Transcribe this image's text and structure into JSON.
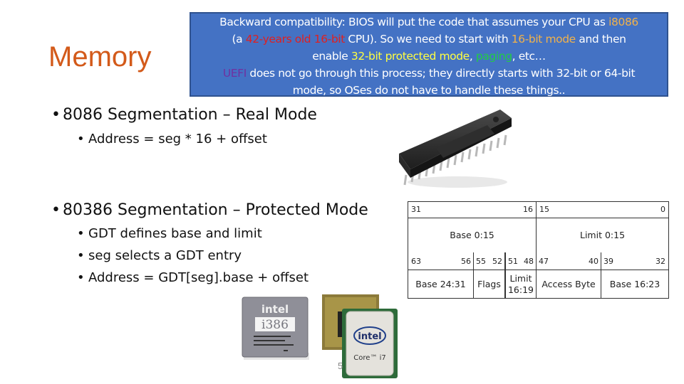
{
  "slide": {
    "title": "Memory",
    "page_number": "5"
  },
  "callout": {
    "lines": [
      [
        {
          "t": "Backward compatibility: BIOS will put the code that assumes your CPU as ",
          "c": "white"
        },
        {
          "t": "i8086",
          "c": "orange"
        }
      ],
      [
        {
          "t": "(a ",
          "c": "white"
        },
        {
          "t": "42-years old 16-bit",
          "c": "red"
        },
        {
          "t": " CPU). So we need to start with ",
          "c": "white"
        },
        {
          "t": "16-bit mode",
          "c": "orange"
        },
        {
          "t": " and then",
          "c": "white"
        }
      ],
      [
        {
          "t": "enable ",
          "c": "white"
        },
        {
          "t": "32-bit protected mode",
          "c": "yellow"
        },
        {
          "t": ", ",
          "c": "white"
        },
        {
          "t": "paging",
          "c": "green"
        },
        {
          "t": ", etc…",
          "c": "white"
        }
      ],
      [
        {
          "t": "UEFI",
          "c": "purple"
        },
        {
          "t": " does not go through this process; they directly starts with 32-bit or 64-bit",
          "c": "white"
        }
      ],
      [
        {
          "t": "mode, so OSes do not have to handle these things..",
          "c": "white"
        }
      ]
    ],
    "colors": {
      "background": "#4472c4",
      "orange": "#f2b24a",
      "red": "#e02020",
      "yellow": "#ffff40",
      "green": "#22cc44",
      "purple": "#7030a0"
    }
  },
  "content": {
    "real_mode": {
      "heading": "8086 Segmentation – Real Mode",
      "items": [
        "Address = seg * 16 + offset"
      ]
    },
    "protected_mode": {
      "heading": "80386 Segmentation – Protected Mode",
      "items": [
        "GDT defines base and limit",
        "seg selects a GDT entry",
        "Address = GDT[seg].base + offset"
      ]
    },
    "bullet_glyph": "•"
  },
  "gdt_table": {
    "top_bits": {
      "b31": "31",
      "b16": "16",
      "b15": "15",
      "b0": "0"
    },
    "top_fields": [
      "Base 0:15",
      "Limit 0:15"
    ],
    "bottom_bits": [
      [
        "63",
        "56"
      ],
      [
        "55",
        "52"
      ],
      [
        "51",
        "48"
      ],
      [
        "47",
        "40"
      ],
      [
        "39",
        "32"
      ]
    ],
    "bottom_fields": [
      "Base 24:31",
      "Flags",
      "Limit\n16:19",
      "Access Byte",
      "Base 16:23"
    ]
  },
  "images": {
    "dip_chip": "Intel 8086 DIP chip photo",
    "i386": {
      "brand": "intel",
      "model": "i386"
    },
    "core_i7": {
      "brand": "intel",
      "model": "Core™ i7"
    }
  }
}
